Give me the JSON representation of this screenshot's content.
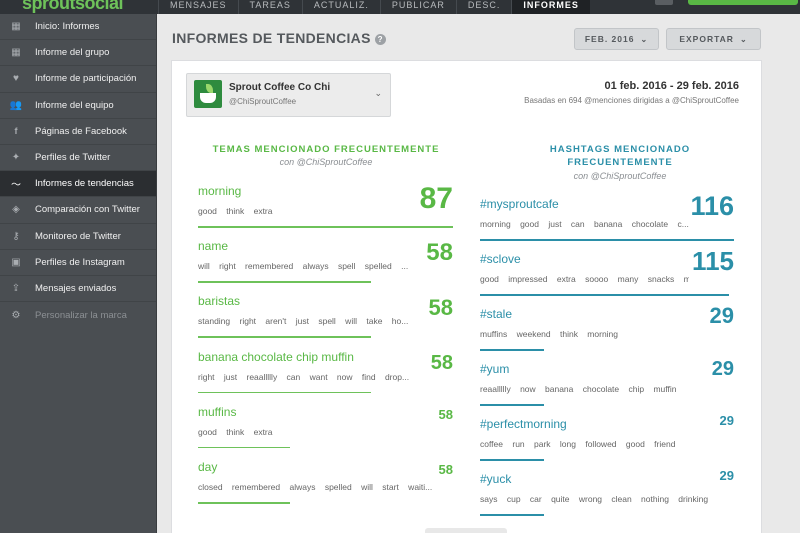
{
  "app": {
    "logo": "sproutsocial"
  },
  "nav": {
    "tabs": [
      "MENSAJES",
      "TAREAS",
      "ACTUALIZ.",
      "PUBLICAR",
      "DESC.",
      "INFORMES"
    ],
    "active": "INFORMES"
  },
  "sidebar": {
    "items": [
      {
        "label": "Inicio: Informes",
        "icon": "grid-icon"
      },
      {
        "label": "Informe del grupo",
        "icon": "grid-icon"
      },
      {
        "label": "Informe de participación",
        "icon": "heart-icon"
      },
      {
        "label": "Informe del equipo",
        "icon": "team-icon"
      },
      {
        "label": "Páginas de Facebook",
        "icon": "facebook-icon"
      },
      {
        "label": "Perfiles de Twitter",
        "icon": "twitter-icon"
      },
      {
        "label": "Informes de tendencias",
        "icon": "trends-icon",
        "active": true
      },
      {
        "label": "Comparación con Twitter",
        "icon": "compare-icon"
      },
      {
        "label": "Monitoreo de Twitter",
        "icon": "key-icon"
      },
      {
        "label": "Perfiles de Instagram",
        "icon": "instagram-icon"
      },
      {
        "label": "Mensajes enviados",
        "icon": "send-icon"
      },
      {
        "label": "Personalizar la marca",
        "icon": "gear-icon",
        "disabled": true
      }
    ]
  },
  "header": {
    "title": "INFORMES DE TENDENCIAS",
    "help": "?",
    "month_button": "FEB. 2016",
    "export_button": "EXPORTAR"
  },
  "profile": {
    "name": "Sprout Coffee Co Chi",
    "handle": "@ChiSproutCoffee"
  },
  "range": {
    "dates": "01 feb. 2016 - 29 feb. 2016",
    "subtitle": "Basadas en 694 @menciones dirigidas a @ChiSproutCoffee"
  },
  "topics": {
    "title": "TEMAS MENCIONADO FRECUENTEMENTE",
    "subtitle": "con @ChiSproutCoffee",
    "color": "#59b845",
    "rows": [
      {
        "term": "morning",
        "words": "good think extra",
        "count": 87,
        "fraction": 1.0
      },
      {
        "term": "name",
        "words": "will right remembered always spell spelled ...",
        "count": 58,
        "fraction": 0.68
      },
      {
        "term": "baristas",
        "words": "standing right aren't just spell will take ho...",
        "count": 58,
        "fraction": 0.68
      },
      {
        "term": "banana chocolate chip muffin",
        "words": "right just reaallllly can want now find drop...",
        "count": 58,
        "fraction": 0.68
      },
      {
        "term": "muffins",
        "words": "good think extra",
        "count": 58,
        "fraction": 0.36
      },
      {
        "term": "day",
        "words": "closed remembered always spelled will start waiti...",
        "count": 58,
        "fraction": 0.36
      }
    ]
  },
  "hashtags": {
    "title": "HASHTAGS MENCIONADO FRECUENTEMENTE",
    "subtitle": "con @ChiSproutCoffee",
    "color": "#2b8fa8",
    "rows": [
      {
        "term": "#mysproutcafe",
        "words": "morning good just can banana chocolate c...",
        "count": 116,
        "fraction": 1.0
      },
      {
        "term": "#sclove",
        "words": "good impressed extra soooo many snacks m...",
        "count": 115,
        "fraction": 0.98
      },
      {
        "term": "#stale",
        "words": "muffins weekend think morning",
        "count": 29,
        "fraction": 0.25
      },
      {
        "term": "#yum",
        "words": "reaallllly now banana chocolate chip muffin",
        "count": 29,
        "fraction": 0.25
      },
      {
        "term": "#perfectmorning",
        "words": "coffee run park long followed good friend",
        "count": 29,
        "fraction": 0.25
      },
      {
        "term": "#yuck",
        "words": "says cup car quite wrong clean nothing drinking",
        "count": 29,
        "fraction": 0.25
      }
    ]
  }
}
